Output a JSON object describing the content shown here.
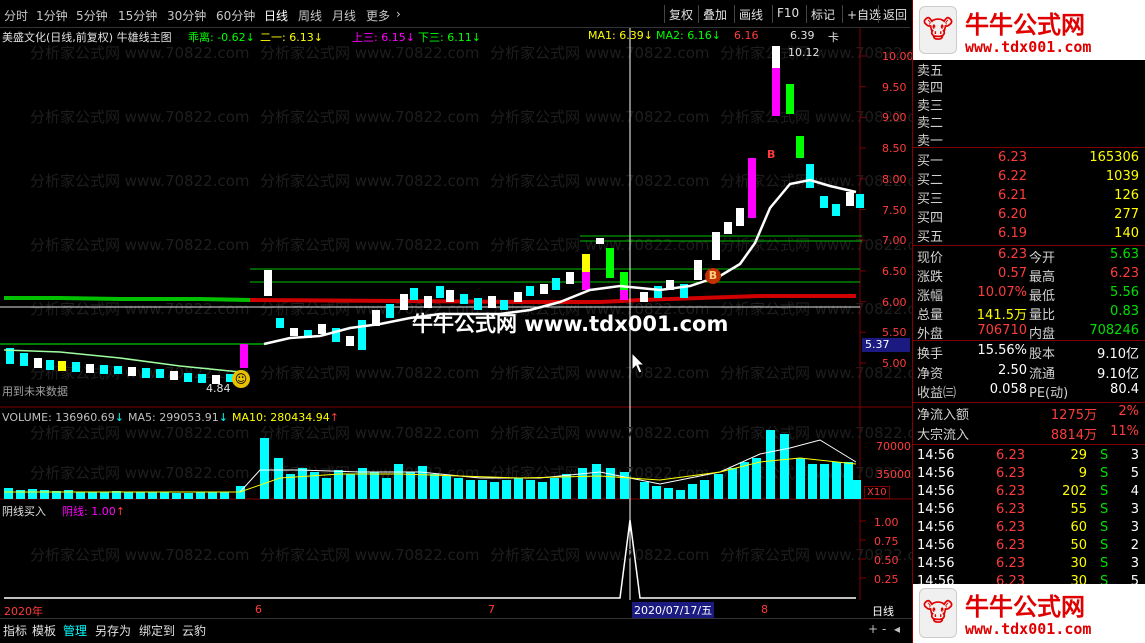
{
  "toolbar": {
    "periods": [
      "分时",
      "1分钟",
      "5分钟",
      "15分钟",
      "30分钟",
      "60分钟",
      "日线",
      "周线",
      "月线",
      "更多"
    ],
    "active_period": "日线",
    "buttons": [
      "复权",
      "叠加",
      "画线",
      "F10",
      "标记",
      "+自选",
      "返回"
    ]
  },
  "main": {
    "title": "美盛文化(日线,前复权) 牛雄线主图",
    "legend": [
      {
        "label": "乖离",
        "value": "-0.62",
        "color": "#00ff00"
      },
      {
        "label": "二一",
        "value": "6.13",
        "color": "#ffff00"
      },
      {
        "label": "上三",
        "value": "6.15",
        "color": "#ff00ff"
      },
      {
        "label": "下三",
        "value": "6.11",
        "color": "#00ff00"
      },
      {
        "label": "MA1",
        "value": "6.39",
        "color": "#ffff00"
      },
      {
        "label": "MA2",
        "value": "6.16",
        "color": "#00ff00"
      }
    ],
    "extra_labels": [
      "6.16",
      "6.39",
      "卡"
    ],
    "note": "用到未来数据",
    "high_label": "10.12",
    "low_label": "4.84",
    "b_markers": [
      "B",
      "B"
    ],
    "watermark_center": "牛牛公式网 www.tdx001.com",
    "watermark_tile": "分析家公式网 www.70822.com",
    "price_axis": [
      "10.00",
      "9.50",
      "9.00",
      "8.50",
      "8.00",
      "7.50",
      "7.00",
      "6.50",
      "6.00",
      "5.50",
      "5.00"
    ],
    "current_price_tag": "5.37"
  },
  "volume": {
    "legend": [
      {
        "label": "VOLUME",
        "value": "136960.69",
        "color": "#c0c0c0"
      },
      {
        "label": "MA5",
        "value": "299053.91",
        "color": "#c0c0c0"
      },
      {
        "label": "MA10",
        "value": "280434.94",
        "color": "#ffff00"
      }
    ],
    "axis": [
      "70000",
      "35000"
    ],
    "unit": "X10"
  },
  "indicator": {
    "title": "阴线买入",
    "legend_label": "阴线",
    "legend_value": "1.00",
    "axis": [
      "1.00",
      "0.75",
      "0.50",
      "0.25"
    ]
  },
  "timeaxis": {
    "labels": [
      "2020年",
      "6",
      "7",
      "8"
    ],
    "cursor_date": "2020/07/17/五",
    "right_label": "日线"
  },
  "bottom": {
    "buttons": [
      "指标",
      "模板",
      "管理",
      "另存为",
      "绑定到",
      "云豹"
    ],
    "active": "管理"
  },
  "logo": {
    "title": "牛牛公式网",
    "url": "www.tdx001.com"
  },
  "quote": {
    "sell": [
      {
        "label": "卖五"
      },
      {
        "label": "卖四"
      },
      {
        "label": "卖三"
      },
      {
        "label": "卖二"
      },
      {
        "label": "卖一"
      }
    ],
    "buy": [
      {
        "label": "买一",
        "price": "6.23",
        "vol": "165306"
      },
      {
        "label": "买二",
        "price": "6.22",
        "vol": "1039"
      },
      {
        "label": "买三",
        "price": "6.21",
        "vol": "126"
      },
      {
        "label": "买四",
        "price": "6.20",
        "vol": "277"
      },
      {
        "label": "买五",
        "price": "6.19",
        "vol": "140"
      }
    ],
    "stats": [
      {
        "l1": "现价",
        "v1": "6.23",
        "l2": "今开",
        "v2": "5.63",
        "c1": "red",
        "c2": "green"
      },
      {
        "l1": "涨跌",
        "v1": "0.57",
        "l2": "最高",
        "v2": "6.23",
        "c1": "red",
        "c2": "red"
      },
      {
        "l1": "涨幅",
        "v1": "10.07%",
        "l2": "最低",
        "v2": "5.56",
        "c1": "red",
        "c2": "green"
      },
      {
        "l1": "总量",
        "v1": "141.5万",
        "l2": "量比",
        "v2": "0.83",
        "c1": "yellow",
        "c2": "green"
      },
      {
        "l1": "外盘",
        "v1": "706710",
        "l2": "内盘",
        "v2": "708246",
        "c1": "red",
        "c2": "green"
      }
    ],
    "stats2": [
      {
        "l1": "换手",
        "v1": "15.56%",
        "l2": "股本",
        "v2": "9.10亿"
      },
      {
        "l1": "净资",
        "v1": "2.50",
        "l2": "流通",
        "v2": "9.10亿"
      },
      {
        "l1": "收益㈢",
        "v1": "0.058",
        "l2": "PE(动)",
        "v2": "80.4"
      }
    ],
    "flows": [
      {
        "label": "净流入额",
        "value": "1275万",
        "pct": "2%"
      },
      {
        "label": "大宗流入",
        "value": "8814万",
        "pct": "11%"
      }
    ],
    "ticks": [
      {
        "time": "14:56",
        "price": "6.23",
        "vol": "29",
        "side": "S"
      },
      {
        "time": "14:56",
        "price": "6.23",
        "vol": "9",
        "side": "S"
      },
      {
        "time": "14:56",
        "price": "6.23",
        "vol": "202",
        "side": "S"
      },
      {
        "time": "14:56",
        "price": "6.23",
        "vol": "55",
        "side": "S"
      },
      {
        "time": "14:56",
        "price": "6.23",
        "vol": "60",
        "side": "S"
      },
      {
        "time": "14:56",
        "price": "6.23",
        "vol": "50",
        "side": "S"
      },
      {
        "time": "14:56",
        "price": "6.23",
        "vol": "30",
        "side": "S"
      },
      {
        "time": "14:56",
        "price": "6.23",
        "vol": "30",
        "side": "S"
      }
    ],
    "tick_counts": [
      "3",
      "5",
      "4",
      "3",
      "3",
      "2",
      "3",
      "5"
    ]
  }
}
